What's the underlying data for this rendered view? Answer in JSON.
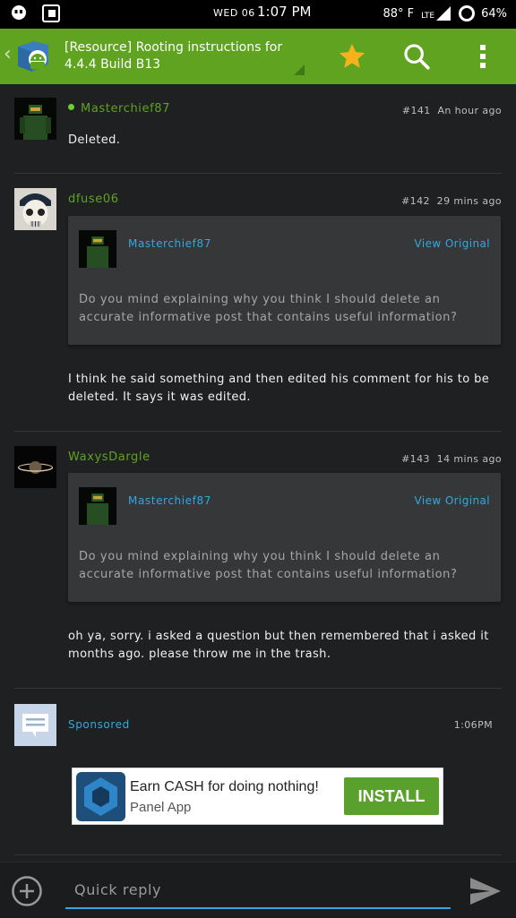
{
  "status_bar": {
    "date": "WED 06",
    "time": "1:07 PM",
    "temperature": "88° F",
    "network": "LTE",
    "battery": "64%"
  },
  "app_bar": {
    "title": "[Resource] Rooting instructions for 4.4.4 Build B13",
    "icons": [
      "back-chevron-icon",
      "app-logo-icon",
      "star-icon",
      "search-icon",
      "overflow-menu-icon"
    ],
    "accent_color": "#5fa321",
    "star_color": "#f5b21b"
  },
  "posts": [
    {
      "username": "Masterchief87",
      "online": true,
      "number": "#141",
      "time": "An hour ago",
      "body": "Deleted."
    },
    {
      "username": "dfuse06",
      "number": "#142",
      "time": "29 mins ago",
      "quote": {
        "username": "Masterchief87",
        "link": "View Original",
        "text": "Do you mind explaining why you think I should delete an accurate informative post that contains useful information?"
      },
      "body": "I think he said something and then edited his comment for his to be deleted. It says it was edited."
    },
    {
      "username": "WaxysDargle",
      "number": "#143",
      "time": "14 mins ago",
      "quote": {
        "username": "Masterchief87",
        "link": "View Original",
        "text": "Do you mind explaining why you think I should delete an accurate informative post that contains useful information?"
      },
      "body": "oh ya, sorry. i asked a question but then remembered that i asked it months ago. please throw me in the trash."
    }
  ],
  "sponsored": {
    "label": "Sponsored",
    "time": "1:06PM",
    "ad": {
      "headline": "Earn CASH for doing nothing!",
      "app_name": "Panel App",
      "button": "INSTALL"
    }
  },
  "reply": {
    "placeholder": "Quick reply"
  },
  "colors": {
    "username": "#5fa321",
    "link": "#33a8e0",
    "background": "#1f2021",
    "quote_background": "#353738"
  }
}
